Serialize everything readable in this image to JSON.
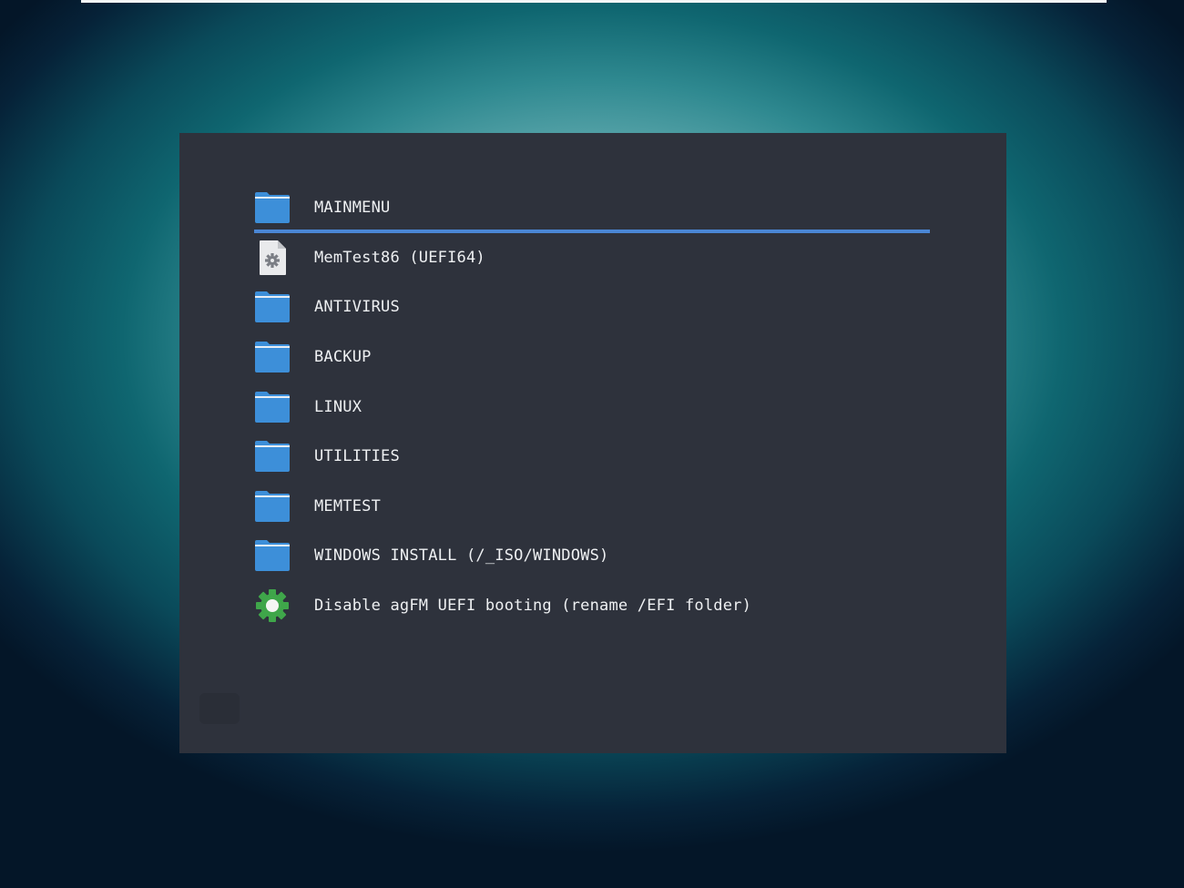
{
  "menu": {
    "selected_index": 0,
    "items": [
      {
        "label": "MAINMENU",
        "icon": "folder-icon"
      },
      {
        "label": "MemTest86 (UEFI64)",
        "icon": "settings-file-icon"
      },
      {
        "label": "ANTIVIRUS",
        "icon": "folder-icon"
      },
      {
        "label": "BACKUP",
        "icon": "folder-icon"
      },
      {
        "label": "LINUX",
        "icon": "folder-icon"
      },
      {
        "label": "UTILITIES",
        "icon": "folder-icon"
      },
      {
        "label": "MEMTEST",
        "icon": "folder-icon"
      },
      {
        "label": "WINDOWS INSTALL (/_ISO/WINDOWS)",
        "icon": "folder-icon"
      },
      {
        "label": "Disable agFM UEFI booting (rename /EFI folder)",
        "icon": "gear-icon"
      }
    ]
  },
  "colors": {
    "panel": "#2e323c",
    "selection": "#4a86d4",
    "folder": "#3d8fd9",
    "gear": "#3fa64a",
    "text": "#eef0f2"
  }
}
